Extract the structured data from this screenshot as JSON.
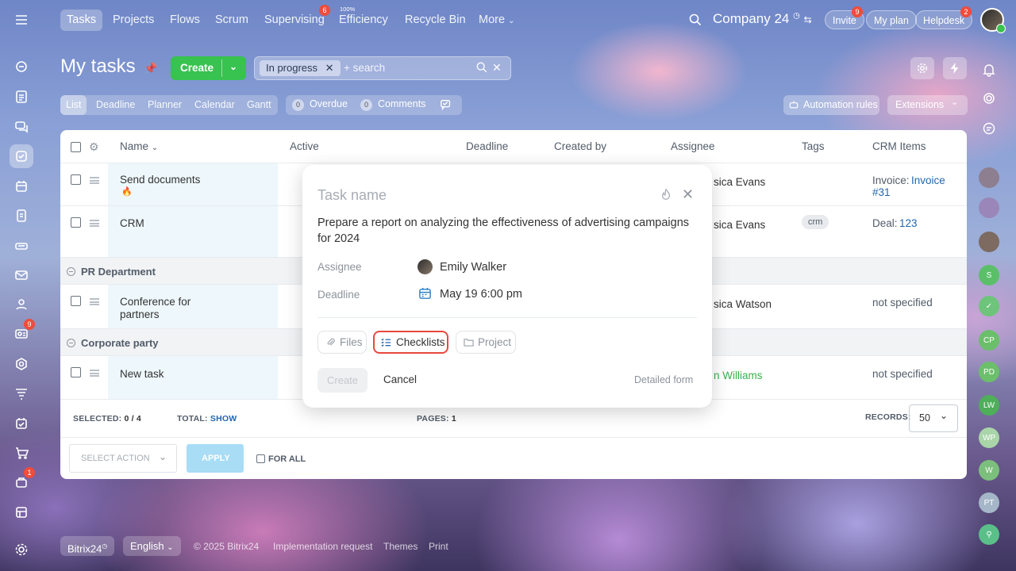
{
  "nav": {
    "items": [
      "Tasks",
      "Projects",
      "Flows",
      "Scrum",
      "Supervising",
      "Efficiency",
      "Recycle Bin",
      "More"
    ],
    "supervising_badge": "6",
    "efficiency_sup": "100%",
    "company": "Company 24",
    "invite": "Invite",
    "invite_badge": "9",
    "my_plan": "My plan",
    "helpdesk": "Helpdesk",
    "helpdesk_badge": "2"
  },
  "sidebar": {
    "badge_contacts": "9",
    "badge_sites": "1"
  },
  "page": {
    "title": "My tasks",
    "create_label": "Create",
    "filter_chip": "In progress",
    "search_placeholder": "+ search",
    "views": [
      "List",
      "Deadline",
      "Planner",
      "Calendar",
      "Gantt"
    ],
    "overdue_label": "Overdue",
    "overdue_count": "0",
    "comments_label": "Comments",
    "comments_count": "0",
    "automation_label": "Automation rules",
    "extensions_label": "Extensions"
  },
  "table": {
    "headers": {
      "name": "Name",
      "active": "Active",
      "deadline": "Deadline",
      "created_by": "Created by",
      "assignee": "Assignee",
      "tags": "Tags",
      "crm": "CRM Items"
    },
    "rows": [
      {
        "name": "Send documents",
        "assignee": "sica Evans",
        "crm_label": "Invoice:",
        "crm_link": "Invoice",
        "crm_link2": "#31"
      },
      {
        "name": "CRM",
        "assignee": "sica Evans",
        "tag": "crm",
        "crm_label": "Deal:",
        "crm_link": "123"
      }
    ],
    "group1": "PR Department",
    "row3": {
      "name_line1": "Conference for",
      "name_line2": "partners",
      "assignee": "sica Watson",
      "crm": "not specified"
    },
    "group2": "Corporate party",
    "row4": {
      "name": "New task",
      "assignee": "n Williams",
      "crm": "not specified"
    },
    "selected_label": "SELECTED:",
    "selected_value": "0 / 4",
    "total_label": "TOTAL:",
    "total_link": "SHOW",
    "pages_label": "PAGES:",
    "pages_value": "1",
    "records_label": "RECORDS:",
    "records_value": "50",
    "select_action": "SELECT ACTION",
    "apply": "APPLY",
    "for_all": "FOR ALL"
  },
  "popup": {
    "task_name_placeholder": "Task name",
    "description": "Prepare a report on analyzing the effectiveness of advertising campaigns for 2024",
    "assignee_label": "Assignee",
    "assignee_value": "Emily Walker",
    "deadline_label": "Deadline",
    "deadline_value": "May 19 6:00 pm",
    "files": "Files",
    "checklists": "Checklists",
    "project": "Project",
    "create": "Create",
    "cancel": "Cancel",
    "detailed_form": "Detailed form"
  },
  "right_sidebar": {
    "avatars": [
      "S",
      "CP",
      "PD",
      "LW",
      "WP",
      "W",
      "PT"
    ]
  },
  "bottom": {
    "brand": "Bitrix24",
    "language": "English",
    "copyright": "© 2025 Bitrix24",
    "impl": "Implementation request",
    "themes": "Themes",
    "print": "Print"
  },
  "colors": {
    "accent_green": "#38c24f",
    "link_blue": "#2067b0",
    "highlight_red": "#e8493d",
    "badge_red": "#f04c3b"
  }
}
